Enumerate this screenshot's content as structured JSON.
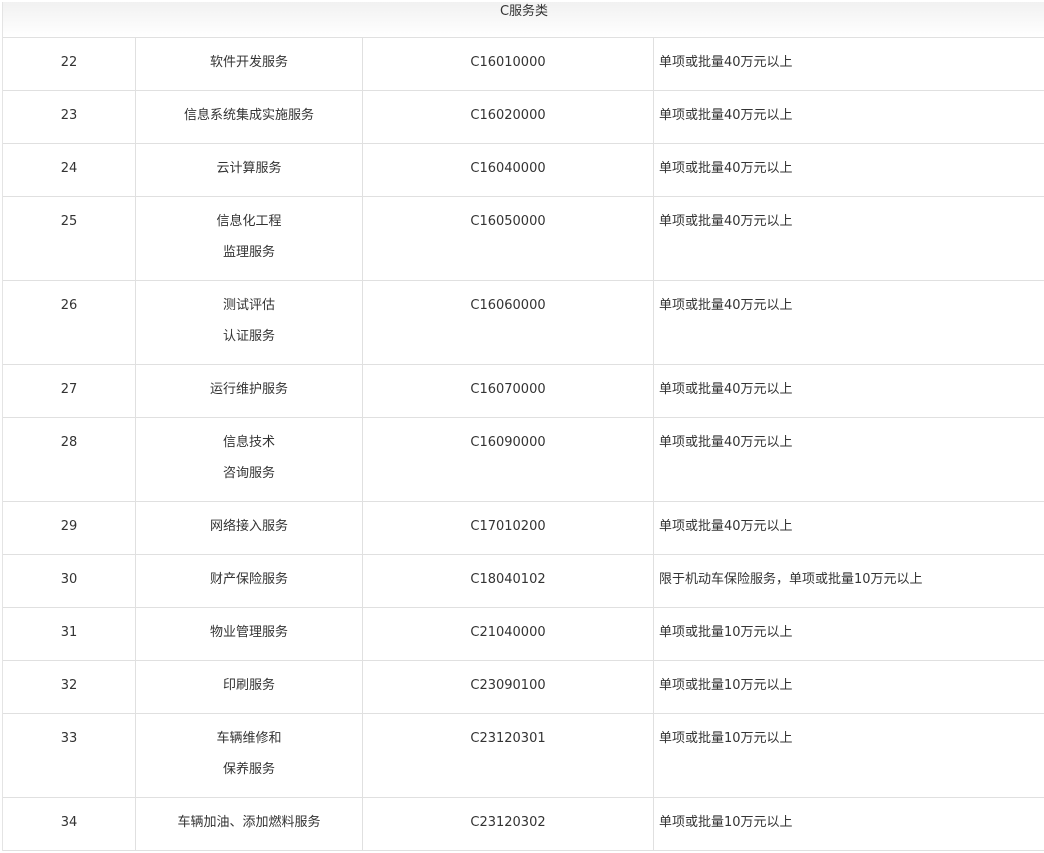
{
  "section_title": "C服务类",
  "rows": [
    {
      "num": "22",
      "name": [
        "软件开发服务"
      ],
      "code": "C16010000",
      "note": "单项或批量40万元以上"
    },
    {
      "num": "23",
      "name": [
        "信息系统集成实施服务"
      ],
      "code": "C16020000",
      "note": "单项或批量40万元以上"
    },
    {
      "num": "24",
      "name": [
        "云计算服务"
      ],
      "code": "C16040000",
      "note": "单项或批量40万元以上"
    },
    {
      "num": "25",
      "name": [
        "信息化工程",
        "监理服务"
      ],
      "code": "C16050000",
      "note": "单项或批量40万元以上"
    },
    {
      "num": "26",
      "name": [
        "测试评估",
        "认证服务"
      ],
      "code": "C16060000",
      "note": "单项或批量40万元以上"
    },
    {
      "num": "27",
      "name": [
        "运行维护服务"
      ],
      "code": "C16070000",
      "note": "单项或批量40万元以上"
    },
    {
      "num": "28",
      "name": [
        "信息技术",
        "咨询服务"
      ],
      "code": "C16090000",
      "note": "单项或批量40万元以上"
    },
    {
      "num": "29",
      "name": [
        "网络接入服务"
      ],
      "code": "C17010200",
      "note": "单项或批量40万元以上"
    },
    {
      "num": "30",
      "name": [
        "财产保险服务"
      ],
      "code": "C18040102",
      "note": "限于机动车保险服务，单项或批量10万元以上"
    },
    {
      "num": "31",
      "name": [
        "物业管理服务"
      ],
      "code": "C21040000",
      "note": "单项或批量10万元以上"
    },
    {
      "num": "32",
      "name": [
        "印刷服务"
      ],
      "code": "C23090100",
      "note": "单项或批量10万元以上"
    },
    {
      "num": "33",
      "name": [
        "车辆维修和",
        "保养服务"
      ],
      "code": "C23120301",
      "note": "单项或批量10万元以上"
    },
    {
      "num": "34",
      "name": [
        "车辆加油、添加燃料服务"
      ],
      "code": "C23120302",
      "note": "单项或批量10万元以上"
    }
  ]
}
